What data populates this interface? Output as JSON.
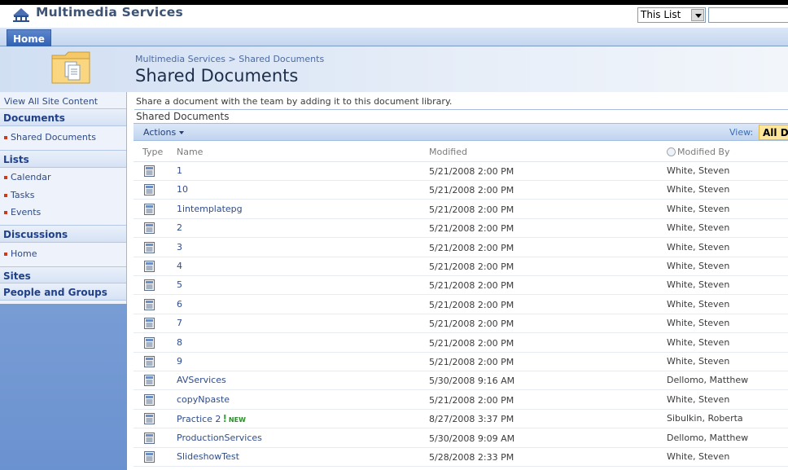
{
  "site": {
    "title": "Multimedia Services",
    "scope_select": "This List",
    "search_placeholder": ""
  },
  "tabs": [
    {
      "label": "Home"
    }
  ],
  "title_area": {
    "breadcrumb": "Multimedia Services > Shared Documents",
    "page_title": "Shared Documents"
  },
  "quicklaunch": {
    "view_all": "View All Site Content",
    "sections": [
      {
        "heading": "Documents",
        "items": [
          "Shared Documents"
        ]
      },
      {
        "heading": "Lists",
        "items": [
          "Calendar",
          "Tasks",
          "Events"
        ]
      },
      {
        "heading": "Discussions",
        "items": [
          "Home"
        ]
      },
      {
        "heading": "Sites",
        "items": []
      },
      {
        "heading": "People and Groups",
        "items": []
      }
    ]
  },
  "library": {
    "description": "Share a document with the team by adding it to this document library.",
    "list_title": "Shared Documents",
    "actions_label": "Actions",
    "view_label": "View:",
    "view_value": "All Documents",
    "columns": {
      "type": "Type",
      "name": "Name",
      "modified": "Modified",
      "modified_by": "Modified By"
    },
    "rows": [
      {
        "name": "1",
        "modified": "5/21/2008 2:00 PM",
        "modified_by": "White, Steven",
        "is_new": false
      },
      {
        "name": "10",
        "modified": "5/21/2008 2:00 PM",
        "modified_by": "White, Steven",
        "is_new": false
      },
      {
        "name": "1intemplatepg",
        "modified": "5/21/2008 2:00 PM",
        "modified_by": "White, Steven",
        "is_new": false
      },
      {
        "name": "2",
        "modified": "5/21/2008 2:00 PM",
        "modified_by": "White, Steven",
        "is_new": false
      },
      {
        "name": "3",
        "modified": "5/21/2008 2:00 PM",
        "modified_by": "White, Steven",
        "is_new": false
      },
      {
        "name": "4",
        "modified": "5/21/2008 2:00 PM",
        "modified_by": "White, Steven",
        "is_new": false
      },
      {
        "name": "5",
        "modified": "5/21/2008 2:00 PM",
        "modified_by": "White, Steven",
        "is_new": false
      },
      {
        "name": "6",
        "modified": "5/21/2008 2:00 PM",
        "modified_by": "White, Steven",
        "is_new": false
      },
      {
        "name": "7",
        "modified": "5/21/2008 2:00 PM",
        "modified_by": "White, Steven",
        "is_new": false
      },
      {
        "name": "8",
        "modified": "5/21/2008 2:00 PM",
        "modified_by": "White, Steven",
        "is_new": false
      },
      {
        "name": "9",
        "modified": "5/21/2008 2:00 PM",
        "modified_by": "White, Steven",
        "is_new": false
      },
      {
        "name": "AVServices",
        "modified": "5/30/2008 9:16 AM",
        "modified_by": "Dellomo, Matthew",
        "is_new": false
      },
      {
        "name": "copyNpaste",
        "modified": "5/21/2008 2:00 PM",
        "modified_by": "White, Steven",
        "is_new": false
      },
      {
        "name": "Practice 2",
        "modified": "8/27/2008 3:37 PM",
        "modified_by": "Sibulkin, Roberta",
        "is_new": true,
        "new_label": "NEW"
      },
      {
        "name": "ProductionServices",
        "modified": "5/30/2008 9:09 AM",
        "modified_by": "Dellomo, Matthew",
        "is_new": false
      },
      {
        "name": "SlideshowTest",
        "modified": "5/28/2008 2:33 PM",
        "modified_by": "White, Steven",
        "is_new": false
      }
    ]
  }
}
